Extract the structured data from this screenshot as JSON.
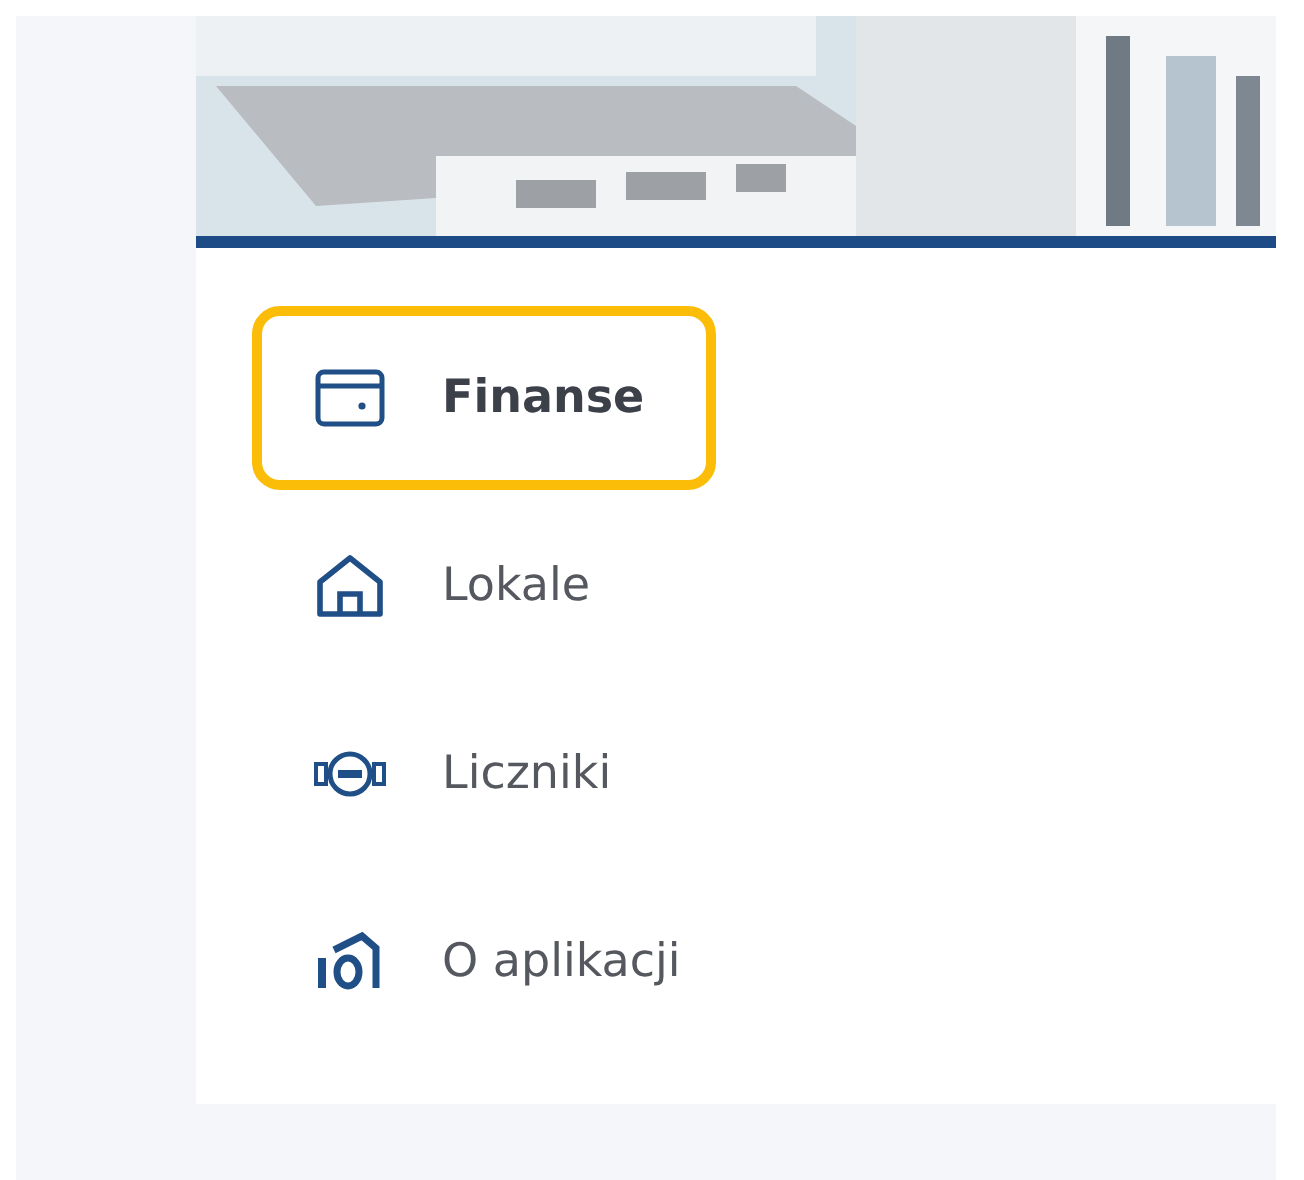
{
  "menu": [
    {
      "label": "Finanse",
      "selected": true
    },
    {
      "label": "Lokale",
      "selected": false
    },
    {
      "label": "Liczniki",
      "selected": false
    },
    {
      "label": "O aplikacji",
      "selected": false
    }
  ]
}
